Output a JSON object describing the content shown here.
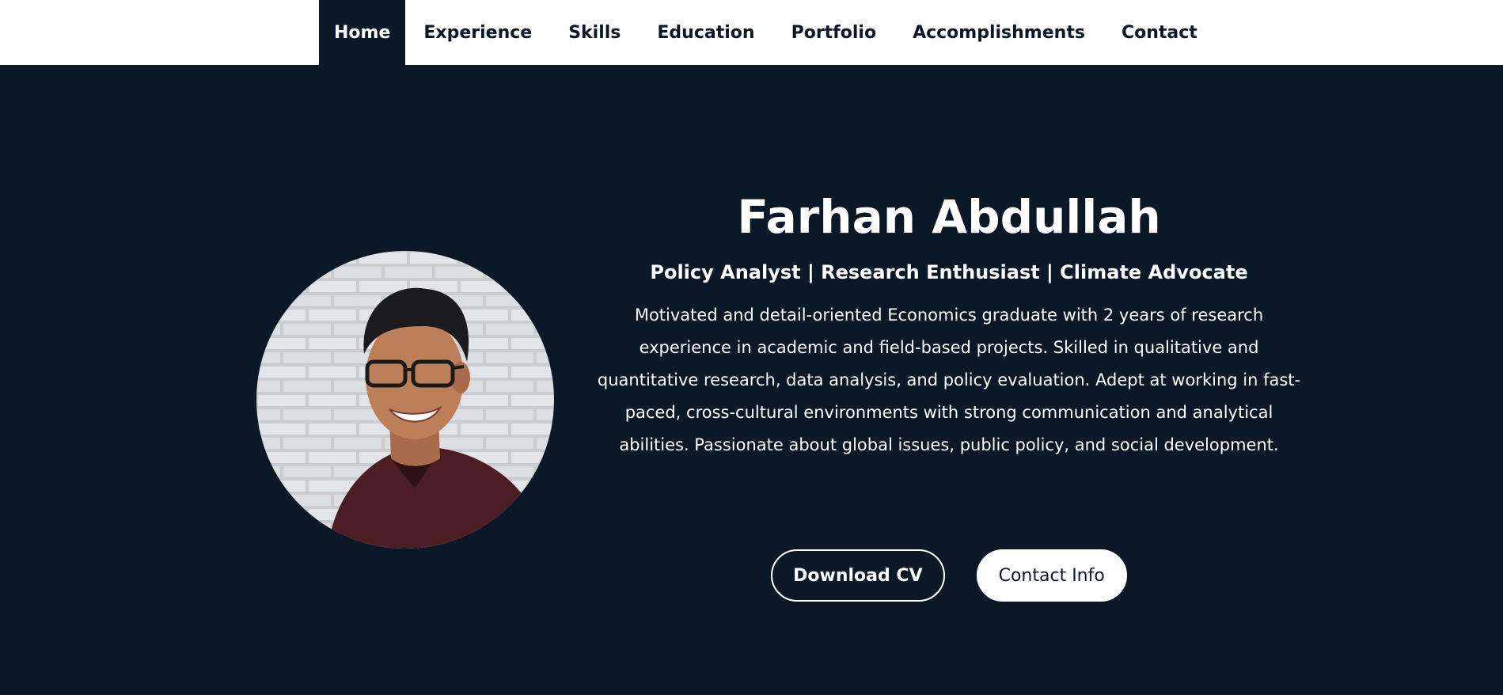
{
  "nav": {
    "items": [
      {
        "label": "Home",
        "active": true
      },
      {
        "label": "Experience"
      },
      {
        "label": "Skills"
      },
      {
        "label": "Education"
      },
      {
        "label": "Portfolio"
      },
      {
        "label": "Accomplishments"
      },
      {
        "label": "Contact"
      }
    ]
  },
  "hero": {
    "name": "Farhan Abdullah",
    "tagline": "Policy Analyst | Research Enthusiast | Climate Advocate",
    "bio": "Motivated and detail-oriented Economics graduate with 2 years of research experience in academic and field-based projects. Skilled in qualitative and quantitative research, data analysis, and policy evaluation. Adept at working in fast-paced, cross-cultural environments with strong communication and analytical abilities. Passionate about global issues, public policy, and social development.",
    "buttons": {
      "download_cv": "Download CV",
      "contact_info": "Contact Info"
    }
  },
  "colors": {
    "background": "#0b1828",
    "navbar": "#ffffff",
    "text": "#ffffff"
  }
}
